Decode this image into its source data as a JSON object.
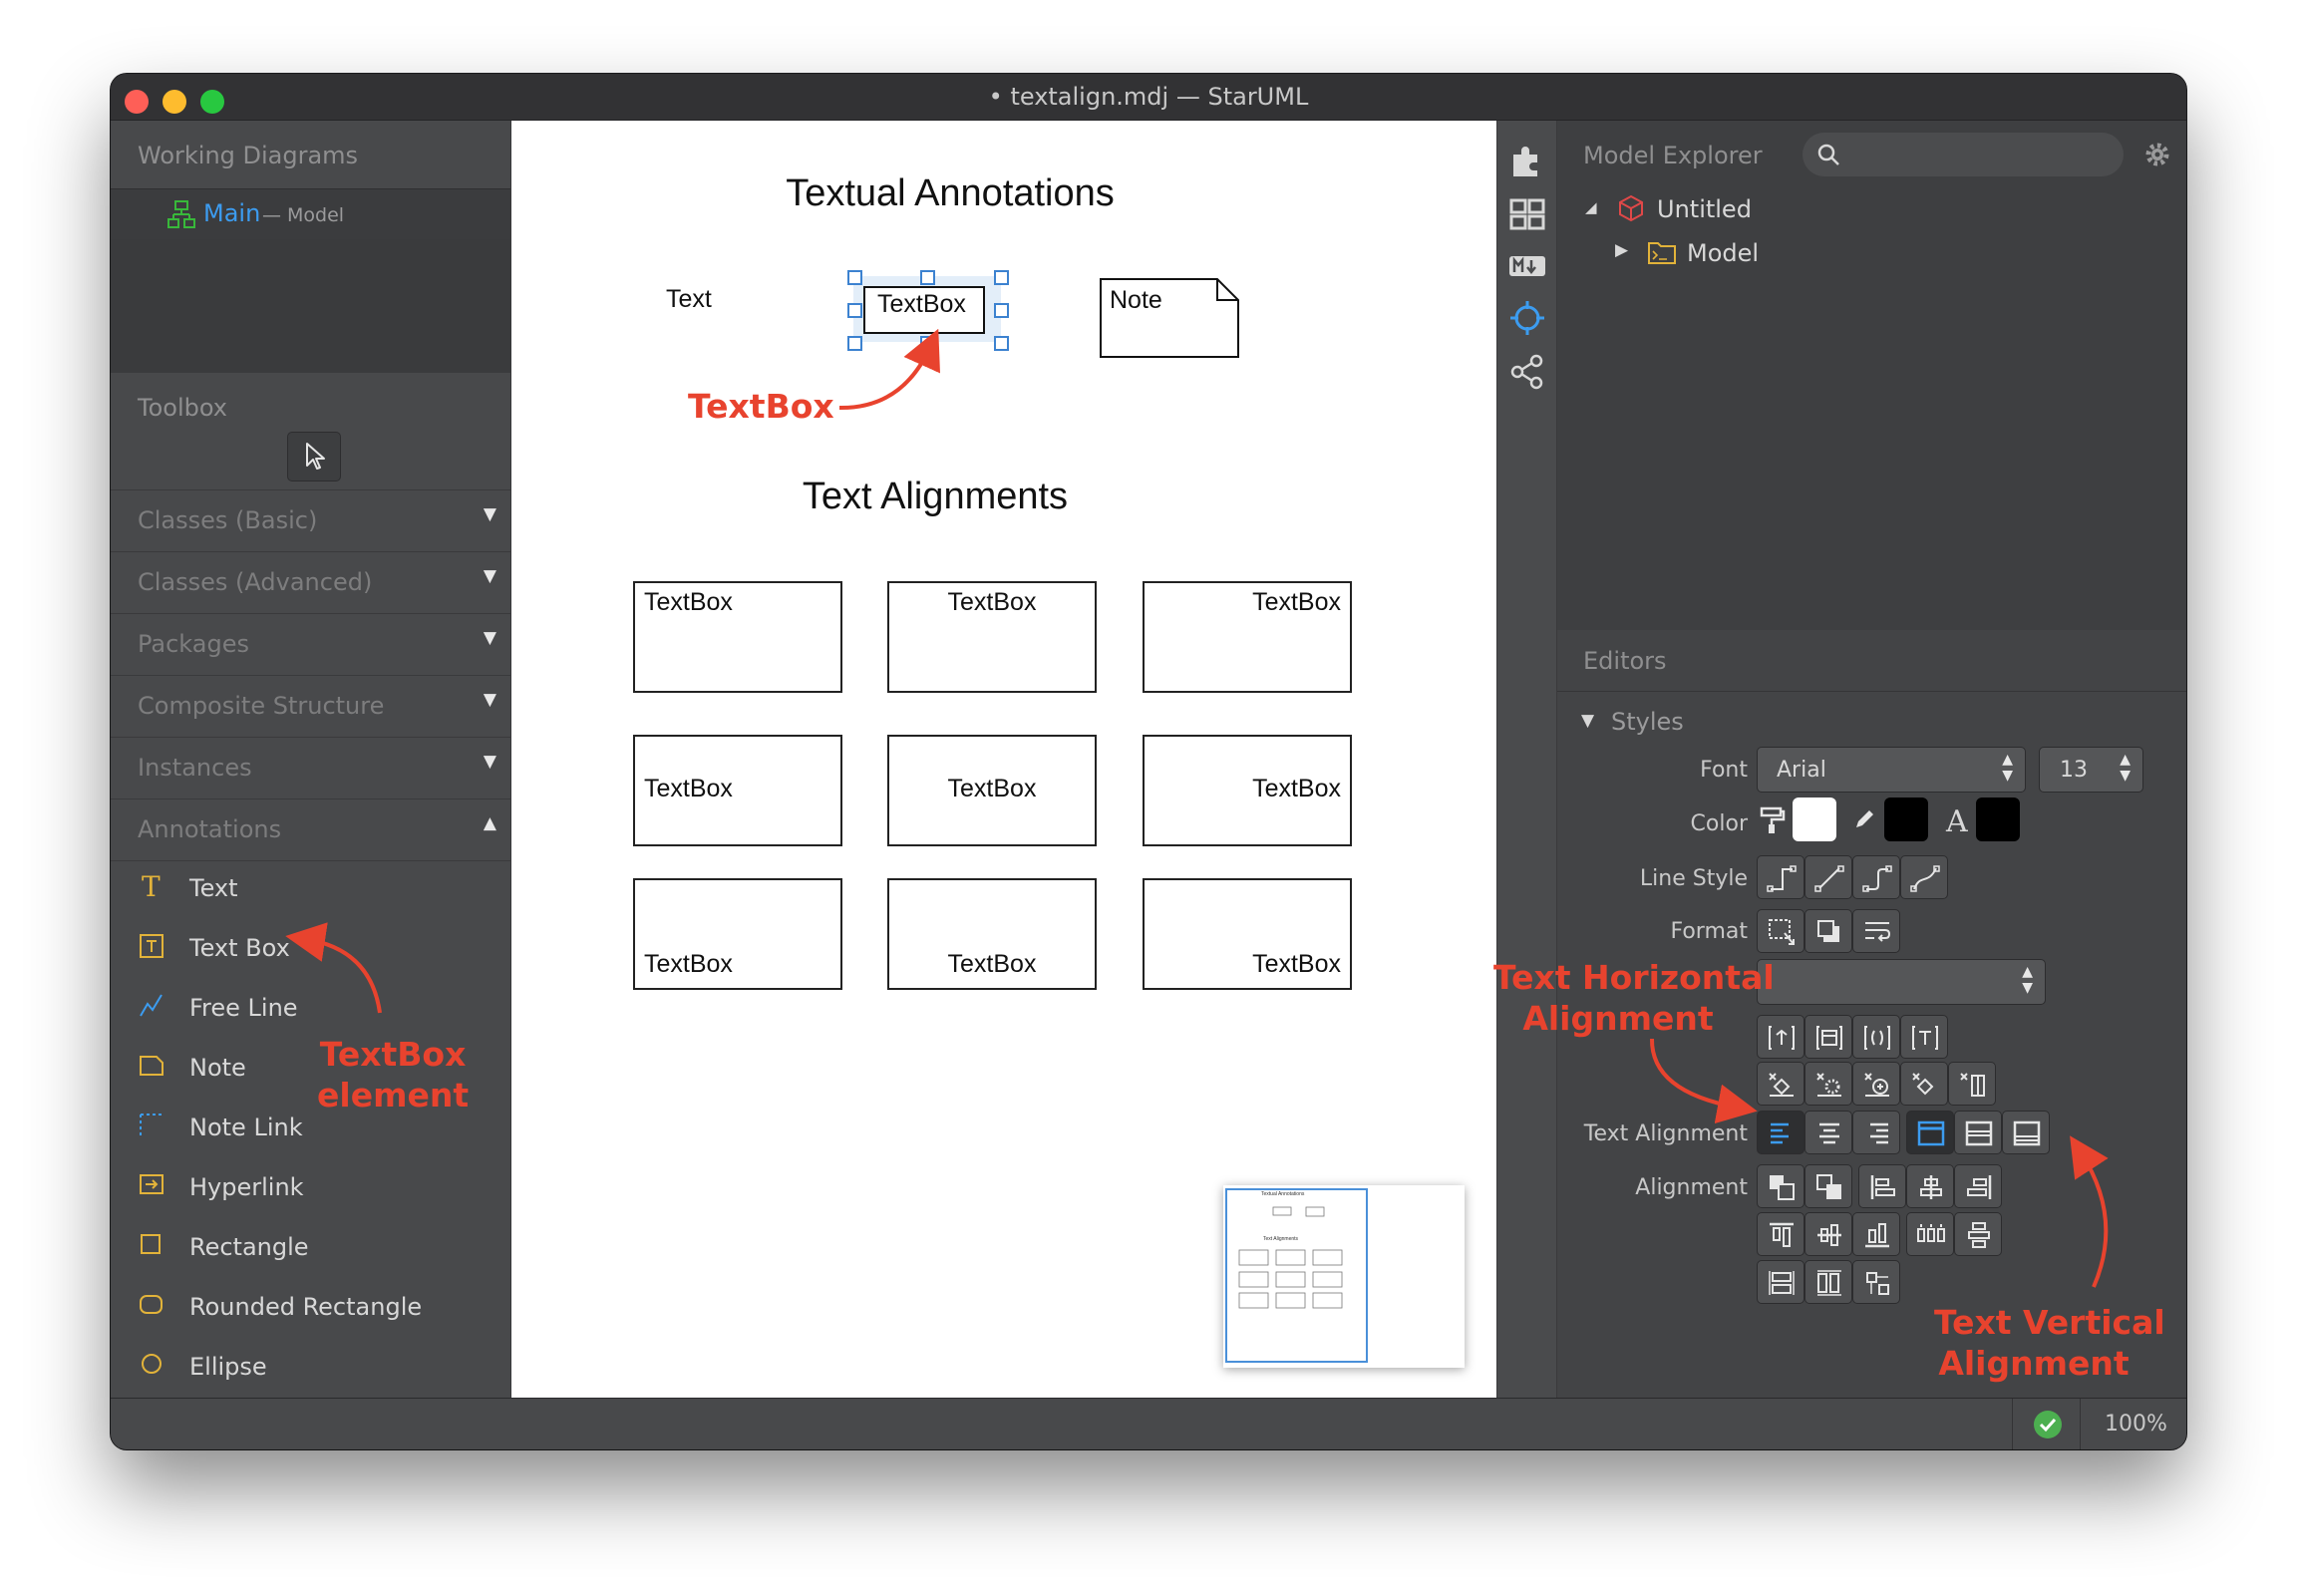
{
  "window": {
    "title": "• textalign.mdj — StarUML",
    "traffic_lights": [
      "#fe5f57",
      "#febc2e",
      "#28c840"
    ]
  },
  "left": {
    "working_diagrams": {
      "header": "Working Diagrams",
      "item_name": "Main",
      "item_suffix": "— Model"
    },
    "toolbox": {
      "header": "Toolbox",
      "categories": [
        {
          "label": "Classes (Basic)",
          "arrow": "▼"
        },
        {
          "label": "Classes (Advanced)",
          "arrow": "▼"
        },
        {
          "label": "Packages",
          "arrow": "▼"
        },
        {
          "label": "Composite Structure",
          "arrow": "▼"
        },
        {
          "label": "Instances",
          "arrow": "▼"
        },
        {
          "label": "Annotations",
          "arrow": "▲"
        }
      ],
      "items": [
        {
          "label": "Text",
          "icon": "text-icon"
        },
        {
          "label": "Text Box",
          "icon": "text-box-icon"
        },
        {
          "label": "Free Line",
          "icon": "free-line-icon"
        },
        {
          "label": "Note",
          "icon": "note-icon"
        },
        {
          "label": "Note Link",
          "icon": "note-link-icon"
        },
        {
          "label": "Hyperlink",
          "icon": "hyperlink-icon"
        },
        {
          "label": "Rectangle",
          "icon": "rectangle-icon"
        },
        {
          "label": "Rounded Rectangle",
          "icon": "rounded-rectangle-icon"
        },
        {
          "label": "Ellipse",
          "icon": "ellipse-icon"
        }
      ]
    }
  },
  "diagram": {
    "heading1": "Textual Annotations",
    "text_label": "Text",
    "selected_textbox": "TextBox",
    "note_label": "Note",
    "heading2": "Text Alignments",
    "grid_boxes": [
      "TextBox",
      "TextBox",
      "TextBox",
      "TextBox",
      "TextBox",
      "TextBox",
      "TextBox",
      "TextBox",
      "TextBox"
    ],
    "minimap_heading1": "Textual Annotations",
    "minimap_heading2": "Text Alignments"
  },
  "explorer": {
    "header": "Model Explorer",
    "search_placeholder": "",
    "tree": [
      {
        "label": "Untitled",
        "expanded": true
      },
      {
        "label": "Model",
        "expanded": false
      }
    ]
  },
  "editors": {
    "header": "Editors",
    "styles_label": "Styles",
    "font_label": "Font",
    "font_value": "Arial",
    "font_size": "13",
    "color_label": "Color",
    "fill_color": "#ffffff",
    "line_color": "#000000",
    "font_color": "#000000",
    "line_style_label": "Line Style",
    "format_label": "Format",
    "format_select_value": "",
    "text_alignment_label": "Text Alignment",
    "alignment_label": "Alignment"
  },
  "statusbar": {
    "zoom": "100%",
    "status_color": "#4caf50"
  },
  "annotations": {
    "textbox_arrow_label": "TextBox",
    "textbox_element_line1": "TextBox",
    "textbox_element_line2": "element",
    "horizontal_line1": "Text Horizontal",
    "horizontal_line2": "Alignment",
    "vertical_line1": "Text Vertical",
    "vertical_line2": "Alignment",
    "color": "#e8432e"
  }
}
